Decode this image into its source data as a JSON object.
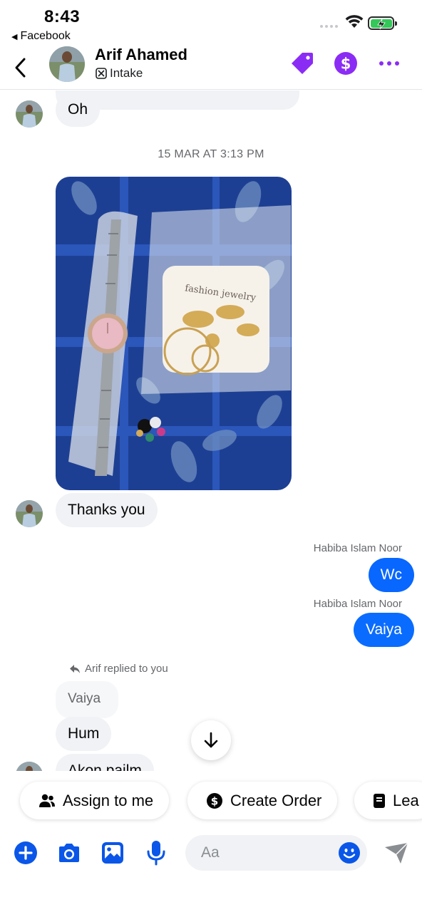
{
  "status_bar": {
    "time": "8:43",
    "back_app": "Facebook"
  },
  "header": {
    "name": "Arif Ahamed",
    "label": "Intake",
    "icons": [
      "chevron-left-icon",
      "tag-icon",
      "dollar-icon",
      "more-icon"
    ],
    "accent": "#8b2cf5"
  },
  "conversation": {
    "messages": [
      {
        "type": "incoming",
        "text": "Oh"
      },
      {
        "type": "timestamp",
        "text": "15 MAR AT 3:13 PM"
      },
      {
        "type": "incoming-photo",
        "text": "fashion jewelry"
      },
      {
        "type": "incoming",
        "text": "Thanks you"
      },
      {
        "type": "outgoing",
        "sender": "Habiba Islam Noor",
        "text": "Wc"
      },
      {
        "type": "outgoing",
        "sender": "Habiba Islam Noor",
        "text": "Vaiya"
      },
      {
        "type": "reply-note",
        "text": "Arif replied to you"
      },
      {
        "type": "quoted",
        "text": "Vaiya"
      },
      {
        "type": "incoming",
        "text": "Hum"
      },
      {
        "type": "incoming",
        "text": "Akon pailm"
      }
    ],
    "bubble_color": "#0a6cff"
  },
  "quick_actions": [
    {
      "label": "Assign to me",
      "icon": "people-icon"
    },
    {
      "label": "Create Order",
      "icon": "dollar-circle-icon"
    },
    {
      "label": "Lea",
      "icon": "document-icon"
    }
  ],
  "composer": {
    "placeholder": "Aa",
    "icons": [
      "plus-icon",
      "camera-icon",
      "gallery-icon",
      "mic-icon",
      "emoji-icon",
      "send-icon"
    ],
    "accent": "#0a56e8"
  }
}
